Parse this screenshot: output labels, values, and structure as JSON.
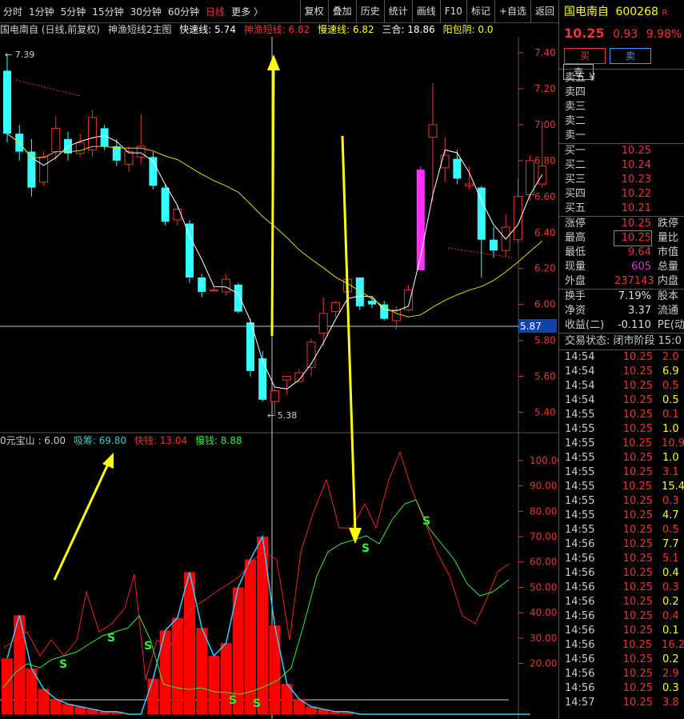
{
  "toolbar": {
    "periods": [
      "分时",
      "1分钟",
      "5分钟",
      "15分钟",
      "30分钟",
      "60分钟",
      "日线",
      "更多 〉"
    ],
    "active_index": 6,
    "actions": [
      "复权",
      "叠加",
      "历史",
      "统计",
      "画线",
      "F10",
      "标记",
      "+自选",
      "返回"
    ]
  },
  "main_title": {
    "stock": "国电南自 (日线,前复权)",
    "indicator": "神渔短线2主图",
    "fast_label": "快速线: 5.74",
    "ss_label": "神渔短线: 6.82",
    "slow_label": "慢速线: 6.82",
    "sanhe_label": "三合: 18.86",
    "yangbao_label": "阳包阴: 0.0"
  },
  "main_axis": {
    "ticks": [
      7.4,
      7.2,
      7.0,
      6.8,
      6.6,
      6.4,
      6.2,
      6.0,
      5.8,
      5.6,
      5.4
    ],
    "crosshair_price": "5.87",
    "high_label": "7.39",
    "low_label": "5.38"
  },
  "sub_title": {
    "name": "0元宝山 : 6.00",
    "xichou": "吸筹: 69.80",
    "kuaiqian": "快钱: 13.04",
    "manqian": "慢钱: 8.88"
  },
  "sub_axis": {
    "ticks": [
      100.0,
      90.0,
      80.0,
      70.0,
      60.0,
      50.0,
      40.0,
      30.0,
      20.0
    ]
  },
  "chart_data": {
    "type": "candlestick",
    "candles": [
      {
        "o": 7.3,
        "h": 7.39,
        "l": 6.9,
        "c": 6.95
      },
      {
        "o": 6.95,
        "h": 7.0,
        "l": 6.8,
        "c": 6.85
      },
      {
        "o": 6.85,
        "h": 6.92,
        "l": 6.6,
        "c": 6.65
      },
      {
        "o": 6.68,
        "h": 6.85,
        "l": 6.66,
        "c": 6.82
      },
      {
        "o": 6.85,
        "h": 7.05,
        "l": 6.8,
        "c": 6.98
      },
      {
        "o": 6.92,
        "h": 6.96,
        "l": 6.8,
        "c": 6.84
      },
      {
        "o": 6.84,
        "h": 6.95,
        "l": 6.82,
        "c": 6.9
      },
      {
        "o": 6.86,
        "h": 7.08,
        "l": 6.82,
        "c": 7.04
      },
      {
        "o": 6.98,
        "h": 7.0,
        "l": 6.86,
        "c": 6.88
      },
      {
        "o": 6.88,
        "h": 6.92,
        "l": 6.77,
        "c": 6.8
      },
      {
        "o": 6.78,
        "h": 6.88,
        "l": 6.74,
        "c": 6.85
      },
      {
        "o": 6.82,
        "h": 7.06,
        "l": 6.78,
        "c": 6.88
      },
      {
        "o": 6.82,
        "h": 6.85,
        "l": 6.64,
        "c": 6.66
      },
      {
        "o": 6.65,
        "h": 6.67,
        "l": 6.44,
        "c": 6.46
      },
      {
        "o": 6.47,
        "h": 6.55,
        "l": 6.44,
        "c": 6.53
      },
      {
        "o": 6.45,
        "h": 6.47,
        "l": 6.12,
        "c": 6.15
      },
      {
        "o": 6.15,
        "h": 6.17,
        "l": 6.04,
        "c": 6.07
      },
      {
        "o": 6.08,
        "h": 6.1,
        "l": 6.07,
        "c": 6.08
      },
      {
        "o": 6.07,
        "h": 6.17,
        "l": 6.05,
        "c": 6.14
      },
      {
        "o": 6.11,
        "h": 6.12,
        "l": 5.95,
        "c": 5.96
      },
      {
        "o": 5.9,
        "h": 5.92,
        "l": 5.6,
        "c": 5.63
      },
      {
        "o": 5.7,
        "h": 5.74,
        "l": 5.46,
        "c": 5.47
      },
      {
        "o": 5.46,
        "h": 5.53,
        "l": 5.38,
        "c": 5.52
      },
      {
        "o": 5.58,
        "h": 5.6,
        "l": 5.5,
        "c": 5.6
      },
      {
        "o": 5.57,
        "h": 5.64,
        "l": 5.57,
        "c": 5.62
      },
      {
        "o": 5.65,
        "h": 5.81,
        "l": 5.6,
        "c": 5.79
      },
      {
        "o": 5.84,
        "h": 6.04,
        "l": 5.77,
        "c": 5.95
      },
      {
        "o": 5.96,
        "h": 6.02,
        "l": 5.93,
        "c": 6.01
      },
      {
        "o": 6.07,
        "h": 6.2,
        "l": 6.05,
        "c": 6.14
      },
      {
        "o": 6.15,
        "h": 6.14,
        "l": 5.97,
        "c": 5.99
      },
      {
        "o": 6.02,
        "h": 6.04,
        "l": 5.98,
        "c": 6.0
      },
      {
        "o": 6.0,
        "h": 6.02,
        "l": 5.91,
        "c": 5.92
      },
      {
        "o": 5.91,
        "h": 5.99,
        "l": 5.86,
        "c": 5.97
      },
      {
        "o": 5.97,
        "h": 6.11,
        "l": 5.96,
        "c": 6.08
      },
      {
        "o": 6.19,
        "h": 6.77,
        "l": 6.19,
        "c": 6.75
      },
      {
        "o": 6.93,
        "h": 7.23,
        "l": 6.57,
        "c": 7.0
      },
      {
        "o": 6.76,
        "h": 6.93,
        "l": 6.68,
        "c": 6.83
      },
      {
        "o": 6.81,
        "h": 6.86,
        "l": 6.67,
        "c": 6.7
      },
      {
        "o": 6.66,
        "h": 6.77,
        "l": 6.64,
        "c": 6.67
      },
      {
        "o": 6.65,
        "h": 6.66,
        "l": 6.15,
        "c": 6.36
      },
      {
        "o": 6.36,
        "h": 6.43,
        "l": 6.26,
        "c": 6.3
      },
      {
        "o": 6.3,
        "h": 6.5,
        "l": 6.27,
        "c": 6.43
      },
      {
        "o": 6.36,
        "h": 6.7,
        "l": 6.34,
        "c": 6.6
      },
      {
        "o": 6.61,
        "h": 6.83,
        "l": 6.58,
        "c": 6.8
      },
      {
        "o": 6.67,
        "h": 7.02,
        "l": 6.65,
        "c": 6.77
      }
    ],
    "sub_bars": [
      22,
      39,
      18,
      10,
      6,
      4,
      3,
      2,
      1,
      1,
      0,
      0,
      14,
      33,
      38,
      56,
      34,
      23,
      28,
      50,
      61,
      70,
      35,
      12,
      6,
      3,
      2,
      1,
      1,
      0,
      0,
      0,
      0,
      0,
      0,
      0,
      0,
      0,
      0,
      0,
      0,
      0,
      0,
      0
    ]
  }
}
